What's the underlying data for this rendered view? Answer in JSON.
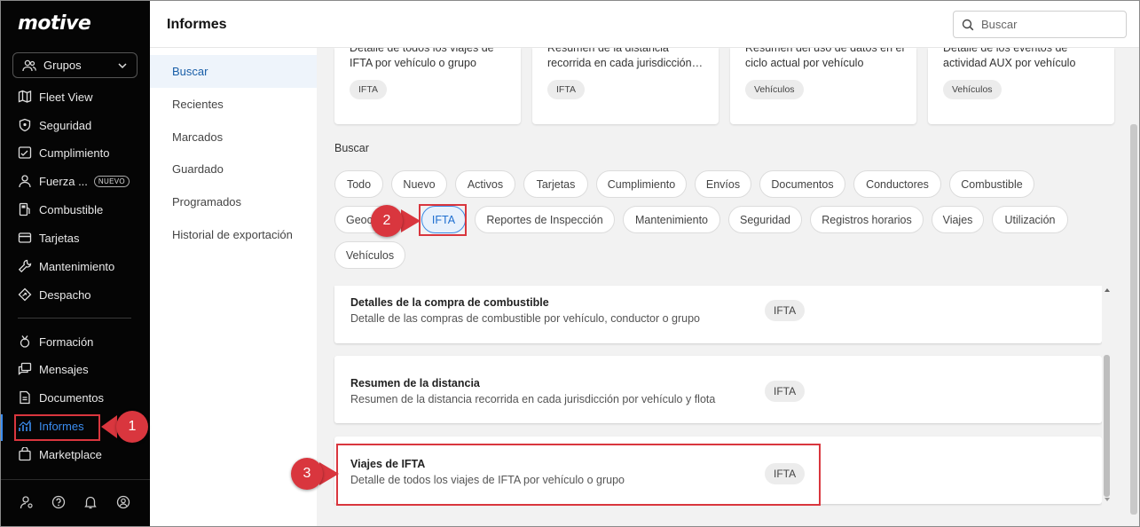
{
  "sidebar": {
    "logo": "motive",
    "groups_label": "Grupos",
    "items": [
      {
        "label": "Fleet View",
        "icon": "map-icon"
      },
      {
        "label": "Seguridad",
        "icon": "shield-icon"
      },
      {
        "label": "Cumplimiento",
        "icon": "compliance-icon"
      },
      {
        "label": "Fuerza ...",
        "icon": "person-icon",
        "badge": "NUEVO"
      },
      {
        "label": "Combustible",
        "icon": "fuel-icon"
      },
      {
        "label": "Tarjetas",
        "icon": "card-icon"
      },
      {
        "label": "Mantenimiento",
        "icon": "wrench-icon"
      },
      {
        "label": "Despacho",
        "icon": "dispatch-icon"
      },
      {
        "label": "Formación",
        "icon": "medal-icon"
      },
      {
        "label": "Mensajes",
        "icon": "messages-icon"
      },
      {
        "label": "Documentos",
        "icon": "document-icon"
      },
      {
        "label": "Informes",
        "icon": "chart-icon"
      },
      {
        "label": "Marketplace",
        "icon": "bag-icon"
      }
    ]
  },
  "header": {
    "title": "Informes",
    "search_placeholder": "Buscar"
  },
  "subnav": {
    "items": [
      "Buscar",
      "Recientes",
      "Marcados",
      "Guardado",
      "Programados",
      "Historial de exportación"
    ]
  },
  "top_cards": [
    {
      "desc": "Detalle de todos los viajes de IFTA por vehículo o grupo",
      "tag": "IFTA"
    },
    {
      "desc": "Resumen de la distancia recorrida en cada jurisdicción…",
      "tag": "IFTA"
    },
    {
      "desc": "Resumen del uso de datos en el ciclo actual por vehículo",
      "tag": "Vehículos"
    },
    {
      "desc": "Detalle de los eventos de actividad AUX por vehículo",
      "tag": "Vehículos"
    }
  ],
  "filter_section": {
    "label": "Buscar",
    "chips": [
      "Todo",
      "Nuevo",
      "Activos",
      "Tarjetas",
      "Cumplimiento",
      "Envíos",
      "Documentos",
      "Conductores",
      "Combustible",
      "Geoc",
      "IFTA",
      "Reportes de Inspección",
      "Mantenimiento",
      "Seguridad",
      "Registros horarios",
      "Viajes",
      "Utilización",
      "Vehículos"
    ],
    "selected": "IFTA"
  },
  "reports": [
    {
      "title": "Detalles de la compra de combustible",
      "desc": "Detalle de las compras de combustible por vehículo, conductor o grupo",
      "tag": "IFTA"
    },
    {
      "title": "Resumen de la distancia",
      "desc": "Resumen de la distancia recorrida en cada jurisdicción por vehículo y flota",
      "tag": "IFTA"
    },
    {
      "title": "Viajes de IFTA",
      "desc": "Detalle de todos los viajes de IFTA por vehículo o grupo",
      "tag": "IFTA"
    }
  ],
  "annotations": [
    "1",
    "2",
    "3"
  ],
  "colors": {
    "accent": "#3b8df0",
    "annotation": "#d9363e",
    "sidebar_bg": "#050505"
  }
}
